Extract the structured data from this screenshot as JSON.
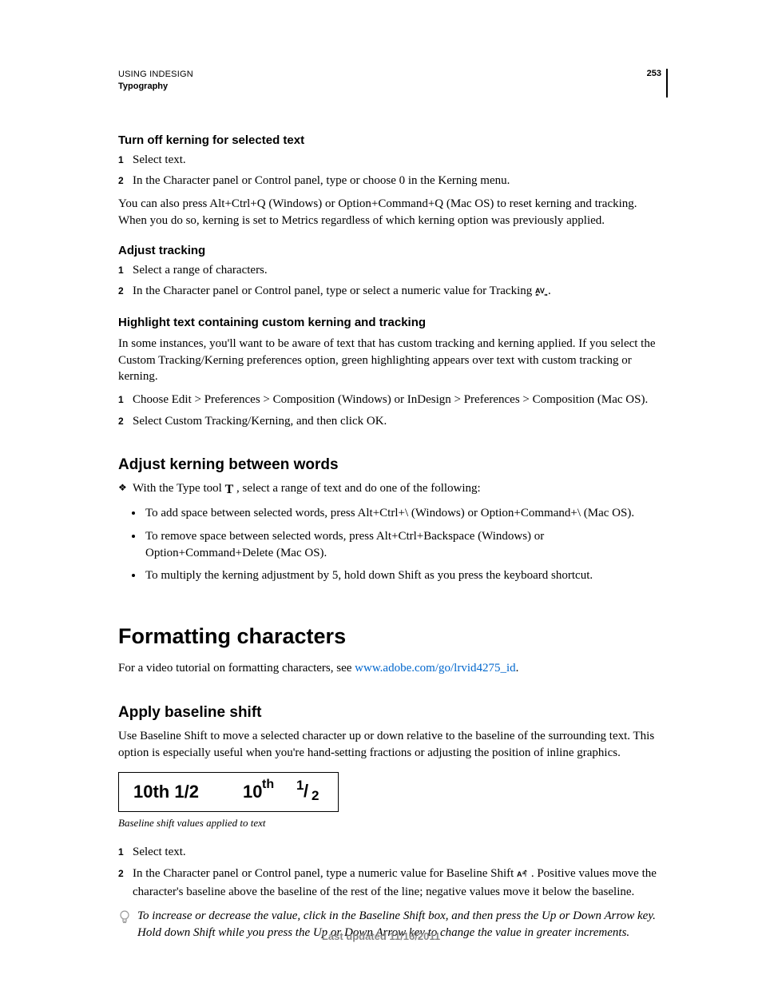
{
  "header": {
    "doc_title": "USING INDESIGN",
    "chapter": "Typography",
    "page_number": "253"
  },
  "sec1": {
    "title": "Turn off kerning for selected text",
    "step1": "Select text.",
    "step2": "In the Character panel or Control panel, type or choose 0 in the Kerning menu.",
    "note": "You can also press Alt+Ctrl+Q (Windows) or Option+Command+Q (Mac OS) to reset kerning and tracking. When you do so, kerning is set to Metrics regardless of which kerning option was previously applied."
  },
  "sec2": {
    "title": "Adjust tracking",
    "step1": "Select a range of characters.",
    "step2a": "In the Character panel or Control panel, type or select a numeric value for Tracking ",
    "step2b": "."
  },
  "sec3": {
    "title": "Highlight text containing custom kerning and tracking",
    "intro": "In some instances, you'll want to be aware of text that has custom tracking and kerning applied. If you select the Custom Tracking/Kerning preferences option, green highlighting appears over text with custom tracking or kerning.",
    "step1": "Choose Edit > Preferences > Composition (Windows) or InDesign > Preferences > Composition (Mac OS).",
    "step2": "Select Custom Tracking/Kerning, and then click OK."
  },
  "sec4": {
    "title": "Adjust kerning between words",
    "lead_a": "With the Type tool ",
    "lead_b": " , select a range of text and do one of the following:",
    "b1": "To add space between selected words, press Alt+Ctrl+\\ (Windows) or Option+Command+\\ (Mac OS).",
    "b2": "To remove space between selected words, press Alt+Ctrl+Backspace (Windows) or Option+Command+Delete (Mac OS).",
    "b3": "To multiply the kerning adjustment by 5, hold down Shift as you press the keyboard shortcut."
  },
  "sec5": {
    "title": "Formatting characters",
    "intro_a": "For a video tutorial on formatting characters, see ",
    "link_text": "www.adobe.com/go/lrvid4275_id",
    "intro_b": "."
  },
  "sec6": {
    "title": "Apply baseline shift",
    "intro": "Use Baseline Shift to move a selected character up or down relative to the baseline of the surrounding text. This option is especially useful when you're hand-setting fractions or adjusting the position of inline graphics.",
    "caption": "Baseline shift values applied to text",
    "step1": "Select text.",
    "step2a": "In the Character panel or Control panel, type a numeric value for Baseline Shift ",
    "step2b": " . Positive values move the character's baseline above the baseline of the rest of the line; negative values move it below the baseline.",
    "tip": "To increase or decrease the value, click in the Baseline Shift box, and then press the Up or Down Arrow key. Hold down Shift while you press the Up or Down Arrow key to change the value in greater increments."
  },
  "figure": {
    "left": "10th 1/2",
    "right_num": "10",
    "right_sup": "th",
    "frac_num": "1",
    "frac_slash": "/",
    "frac_den": "2"
  },
  "footer": "Last updated 11/16/2011"
}
